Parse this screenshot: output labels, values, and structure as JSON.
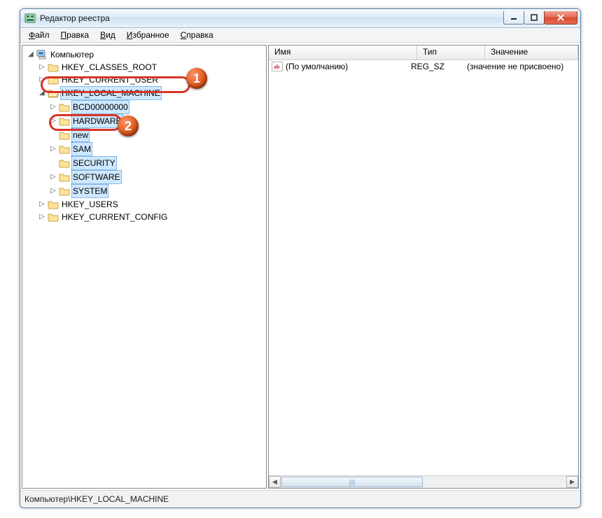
{
  "window": {
    "title": "Редактор реестра"
  },
  "menubar": {
    "file": {
      "mn": "Ф",
      "rest": "айл"
    },
    "edit": {
      "mn": "П",
      "rest": "равка"
    },
    "view": {
      "mn": "В",
      "rest": "ид"
    },
    "fav": {
      "mn": "И",
      "rest": "збранное"
    },
    "help": {
      "mn": "С",
      "rest": "правка"
    }
  },
  "tree": {
    "root": "Компьютер",
    "hives": {
      "hkcr": "HKEY_CLASSES_ROOT",
      "hkcu": "HKEY_CURRENT_USER",
      "hklm": "HKEY_LOCAL_MACHINE",
      "hklm_children": {
        "bcd": "BCD00000000",
        "hardware": "HARDWARE",
        "new": "new",
        "sam": "SAM",
        "security": "SECURITY",
        "software": "SOFTWARE",
        "system": "SYSTEM"
      },
      "hku": "HKEY_USERS",
      "hkcc": "HKEY_CURRENT_CONFIG"
    }
  },
  "list": {
    "headers": {
      "name": "Имя",
      "type": "Тип",
      "value": "Значение"
    },
    "rows": [
      {
        "name": "(По умолчанию)",
        "type": "REG_SZ",
        "value": "(значение не присвоено)"
      }
    ]
  },
  "annotations": {
    "badge1": "1",
    "badge2": "2"
  },
  "statusbar": "Компьютер\\HKEY_LOCAL_MACHINE"
}
